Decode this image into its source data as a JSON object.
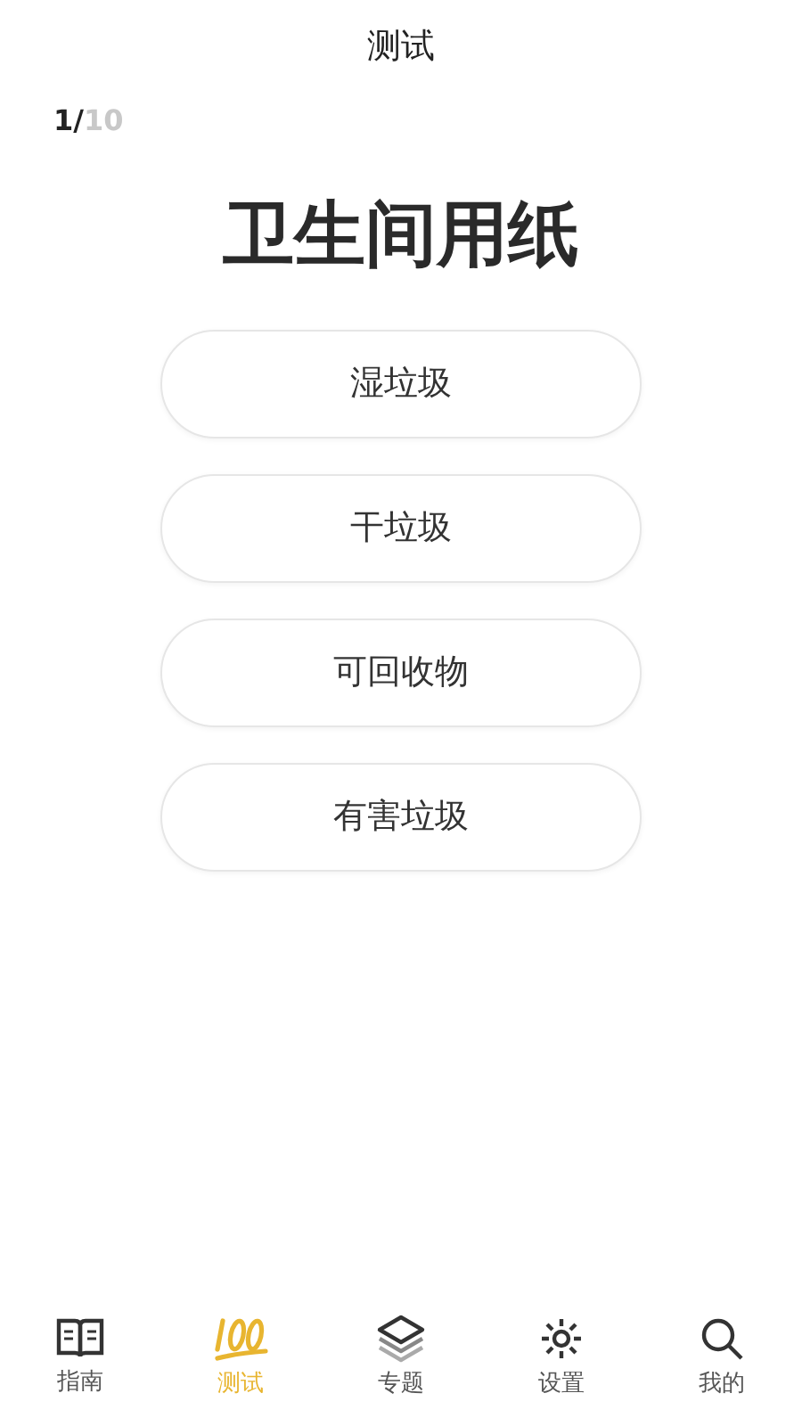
{
  "header": {
    "title": "测试"
  },
  "progress": {
    "current": "1/",
    "total": "10"
  },
  "question": "卫生间用纸",
  "options": [
    {
      "label": "湿垃圾"
    },
    {
      "label": "干垃圾"
    },
    {
      "label": "可回收物"
    },
    {
      "label": "有害垃圾"
    }
  ],
  "tabs": [
    {
      "label": "指南",
      "kind": "book",
      "selected": false
    },
    {
      "label": "测试",
      "kind": "hundred",
      "selected": true
    },
    {
      "label": "专题",
      "kind": "layers",
      "selected": false
    },
    {
      "label": "设置",
      "kind": "gear",
      "selected": false
    },
    {
      "label": "我的",
      "kind": "search",
      "selected": false
    }
  ]
}
